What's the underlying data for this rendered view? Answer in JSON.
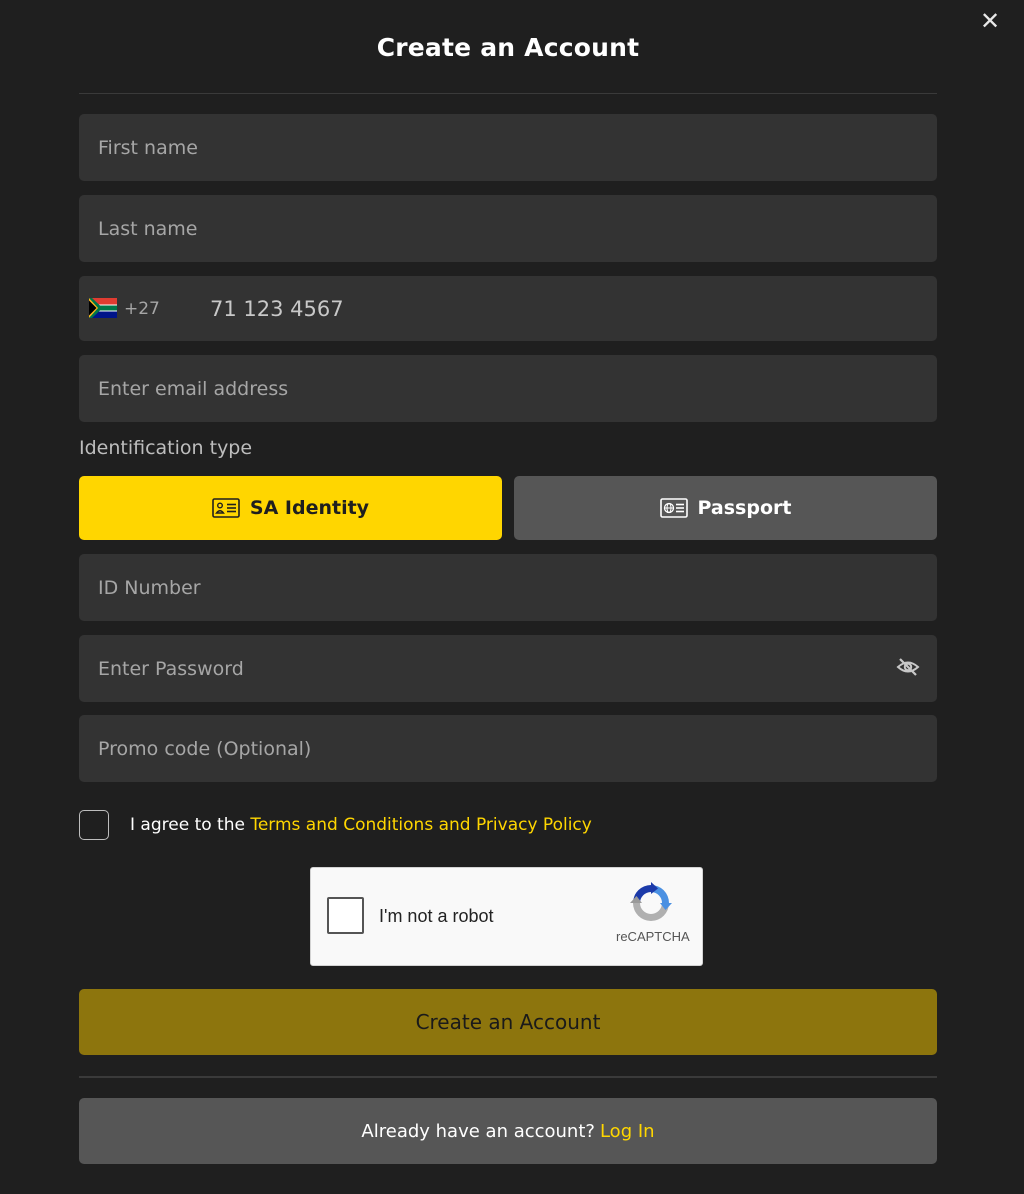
{
  "modal": {
    "title": "Create an Account",
    "close_symbol": "✕"
  },
  "form": {
    "first_name_placeholder": "First name",
    "last_name_placeholder": "Last name",
    "phone": {
      "country_code": "+27",
      "placeholder": "71 123 4567",
      "flag_icon": "south-africa-flag-icon"
    },
    "email_placeholder": "Enter email address",
    "identification": {
      "label": "Identification type",
      "options": [
        {
          "label": "SA Identity",
          "icon": "id-card-icon",
          "selected": true
        },
        {
          "label": "Passport",
          "icon": "passport-icon",
          "selected": false
        }
      ]
    },
    "id_number_placeholder": "ID Number",
    "password_placeholder": "Enter Password",
    "promo_placeholder": "Promo code (Optional)",
    "agree": {
      "text": "I agree to the ",
      "link": "Terms and Conditions and Privacy Policy"
    },
    "captcha": {
      "label": "I'm not a robot",
      "brand": "reCAPTCHA"
    },
    "submit_label": "Create an Account"
  },
  "footer": {
    "text": "Already have an account?",
    "link": "Log In"
  },
  "colors": {
    "background": "#1f1f1f",
    "field": "#333333",
    "accent": "#ffd600",
    "submit_disabled": "#8d750d",
    "secondary": "#565656"
  }
}
